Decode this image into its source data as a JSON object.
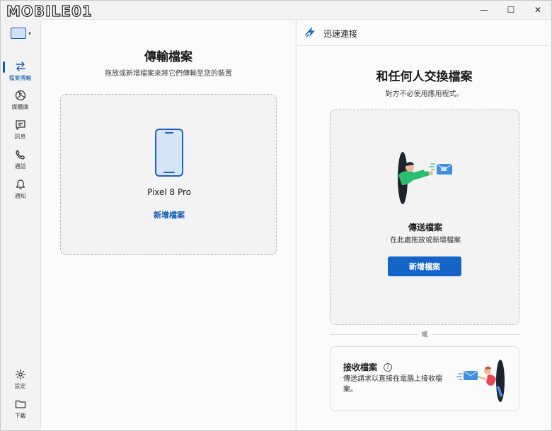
{
  "watermark": {
    "text": "MOBILE01"
  },
  "window": {
    "minimize": "—",
    "maximize": "☐",
    "close": "✕"
  },
  "sidebar": {
    "items": [
      {
        "label": "檔案傳輸",
        "icon": "transfer-icon"
      },
      {
        "label": "媒體庫",
        "icon": "media-icon"
      },
      {
        "label": "訊息",
        "icon": "message-icon"
      },
      {
        "label": "通話",
        "icon": "phone-icon"
      },
      {
        "label": "通知",
        "icon": "bell-icon"
      }
    ],
    "bottom_items": [
      {
        "label": "設定",
        "icon": "gear-icon"
      },
      {
        "label": "下載",
        "icon": "folder-icon"
      }
    ]
  },
  "left_panel": {
    "title": "傳輸檔案",
    "subtitle": "拖放或新增檔案來將它們傳輸至您的裝置",
    "device_name": "Pixel 8 Pro",
    "add_files_link": "新增檔案"
  },
  "right_panel": {
    "header_label": "迅速連接",
    "title": "和任何人交換檔案",
    "subtitle": "對方不必使用應用程式。",
    "send": {
      "title": "傳送檔案",
      "subtitle": "在此處拖放或新增檔案",
      "button": "新增檔案"
    },
    "or_text": "或",
    "receive": {
      "title": "接收檔案",
      "help": "?",
      "description": "傳送請求以直接在電腦上接收檔案。"
    }
  },
  "colors": {
    "accent": "#1565c8",
    "link": "#0f5bb5",
    "background": "#f3f3f3",
    "panel": "#fbfbfb"
  }
}
